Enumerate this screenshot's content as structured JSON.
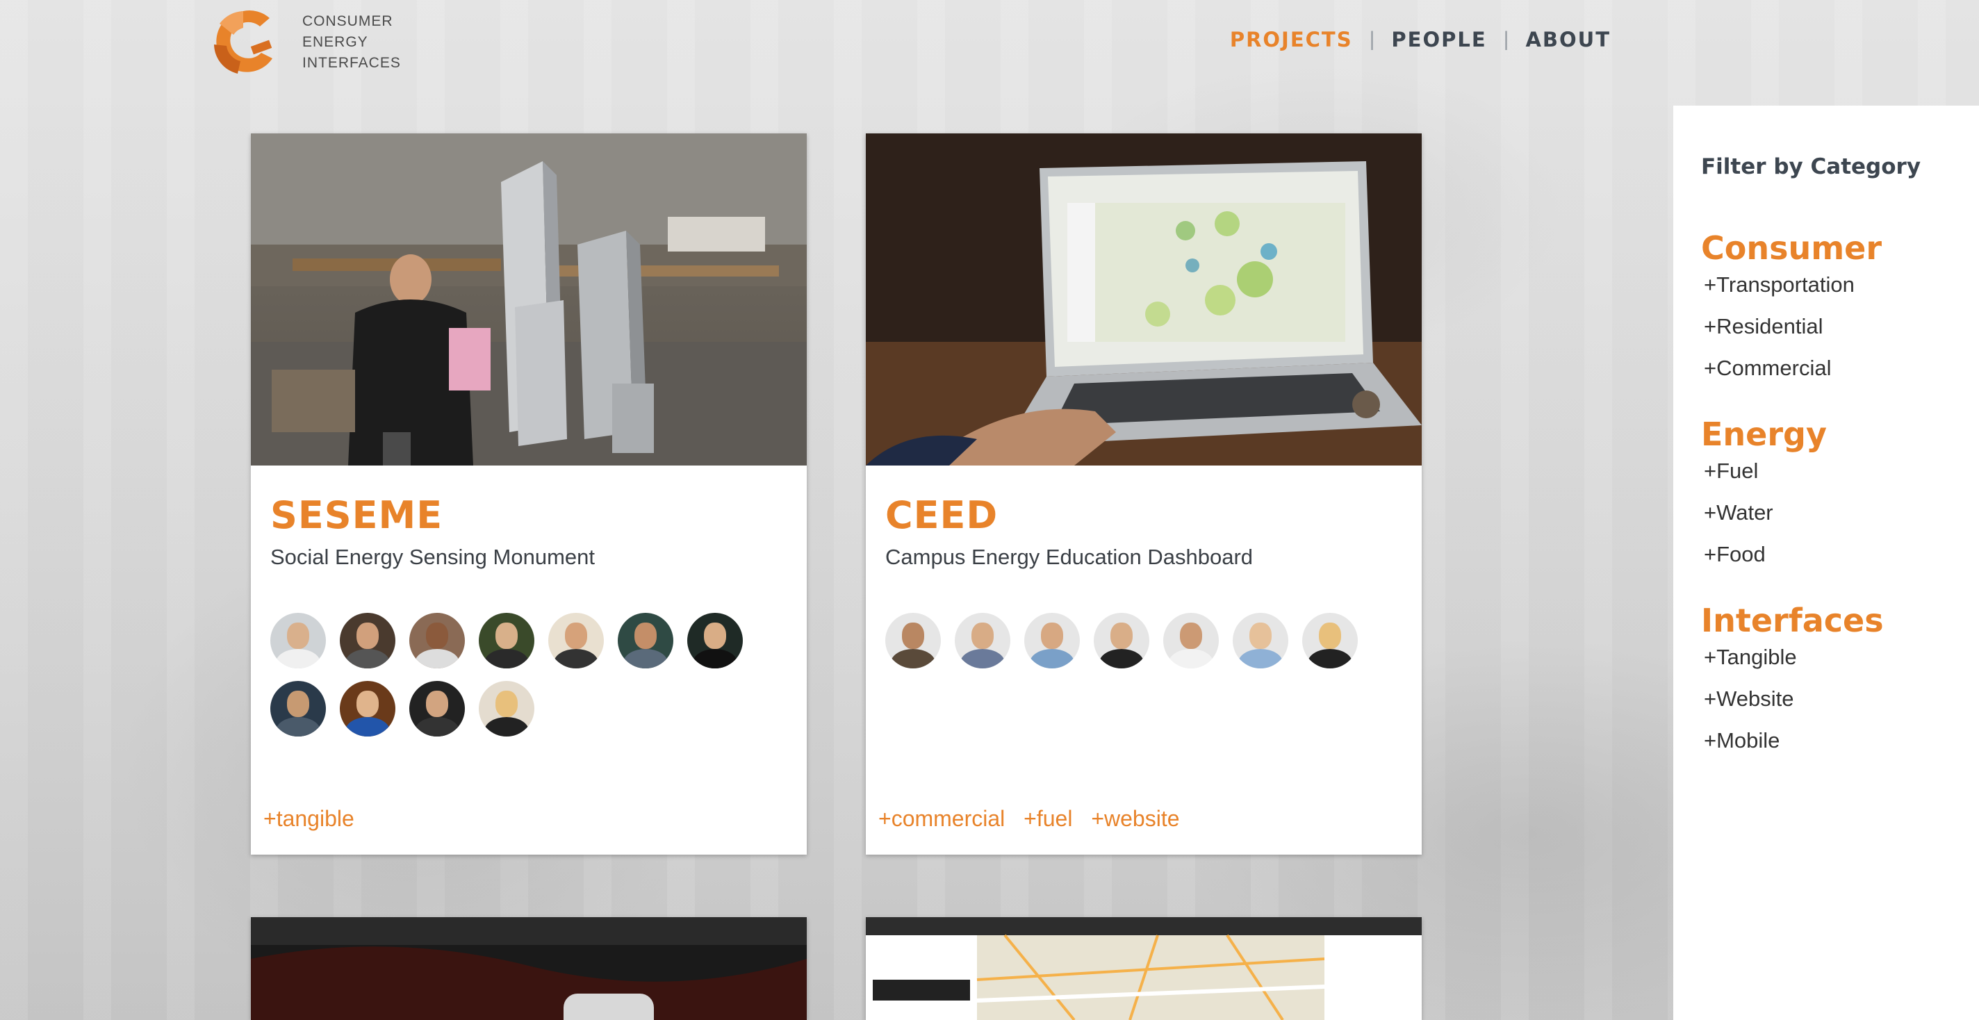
{
  "brand": {
    "logo_lines": [
      "CONSUMER",
      "ENERGY",
      "INTERFACES"
    ],
    "accent_color": "#e8832a",
    "text_color": "#3d4650"
  },
  "nav": {
    "items": [
      {
        "label": "PROJECTS",
        "active": true
      },
      {
        "label": "PEOPLE",
        "active": false
      },
      {
        "label": "ABOUT",
        "active": false
      }
    ]
  },
  "projects": [
    {
      "title": "SESEME",
      "subtitle": "Social Energy Sensing Monument",
      "member_count": 11,
      "tags": [
        "+tangible"
      ]
    },
    {
      "title": "CEED",
      "subtitle": "Campus Energy Education Dashboard",
      "member_count": 7,
      "tags": [
        "+commercial",
        "+fuel",
        "+website"
      ]
    }
  ],
  "sidebar": {
    "title": "Filter by Category",
    "categories": [
      {
        "name": "Consumer",
        "items": [
          "+Transportation",
          "+Residential",
          "+Commercial"
        ]
      },
      {
        "name": "Energy",
        "items": [
          "+Fuel",
          "+Water",
          "+Food"
        ]
      },
      {
        "name": "Interfaces",
        "items": [
          "+Tangible",
          "+Website",
          "+Mobile"
        ]
      }
    ]
  }
}
